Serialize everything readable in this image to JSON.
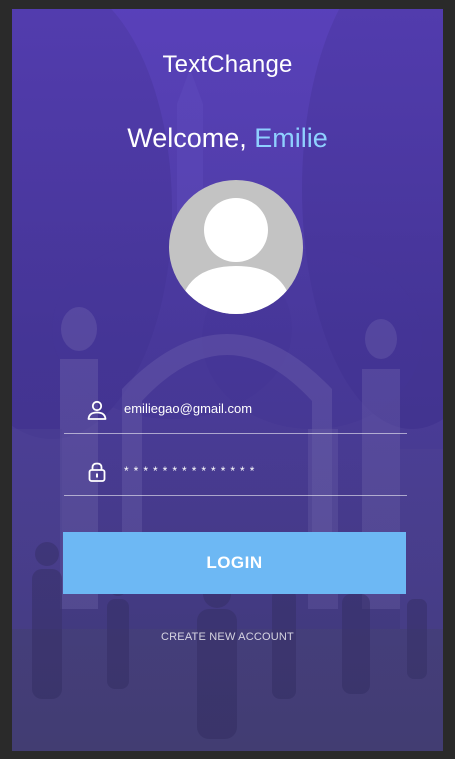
{
  "app": {
    "title": "TextChange"
  },
  "welcome": {
    "prefix": "Welcome, ",
    "name": "Emilie"
  },
  "form": {
    "email_value": "emiliegao@gmail.com",
    "password_value": "**************"
  },
  "actions": {
    "login_label": "LOGIN",
    "create_account_label": "CREATE NEW ACCOUNT"
  },
  "icons": {
    "email_field": "user-icon",
    "password_field": "lock-icon",
    "avatar": "person-silhouette"
  },
  "colors": {
    "accent_name": "#8fd0ff",
    "login_button": "#6db8f4",
    "background_tint": "#4d3aa8",
    "avatar_bg": "#c3c3c3"
  }
}
